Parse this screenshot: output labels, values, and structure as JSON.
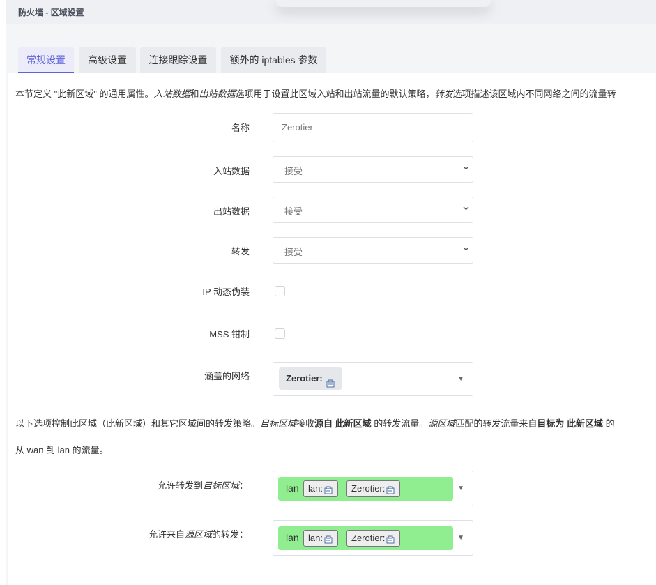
{
  "header": {
    "title": "防火墙 - 区域设置"
  },
  "tabs": [
    {
      "label": "常规设置",
      "active": true
    },
    {
      "label": "高级设置",
      "active": false
    },
    {
      "label": "连接跟踪设置",
      "active": false
    },
    {
      "label": "额外的 iptables 参数",
      "active": false
    }
  ],
  "intro": {
    "t1": "本节定义 \"此新区域\" 的通用属性。",
    "i1": "入站数据",
    "t2": "和",
    "i2": "出站数据",
    "t3": "选项用于设置此区域入站和出站流量的默认策略，",
    "i3": "转发",
    "t4": "选项描述该区域内不同网络之间的流量转"
  },
  "form": {
    "name": {
      "label": "名称",
      "value": "Zerotier"
    },
    "input": {
      "label": "入站数据",
      "value": "接受"
    },
    "output": {
      "label": "出站数据",
      "value": "接受"
    },
    "forward": {
      "label": "转发",
      "value": "接受"
    },
    "masq": {
      "label": "IP 动态伪装",
      "checked": false
    },
    "mss": {
      "label": "MSS 钳制",
      "checked": false
    },
    "networks": {
      "label": "涵盖的网络",
      "chip": "Zerotier:"
    }
  },
  "forwarding_desc": {
    "t1": "以下选项控制此区域（此新区域）和其它区域间的转发策略。",
    "i1": "目标区域",
    "t2": "接收",
    "b1": "源自 此新区域",
    "t3": " 的转发流量。",
    "i2": "源区域",
    "t4": "匹配的转发流量来自",
    "b2": "目标为 此新区域",
    "t5": " 的",
    "line2": "从 wan 到 lan 的流量。"
  },
  "dest": {
    "label_pre": "允许转发到",
    "label_em": "目标区域",
    "label_post": "：",
    "zone": "lan",
    "tag1": "lan:",
    "tag2": "Zerotier:",
    "zone_color": "#90ee90"
  },
  "src": {
    "label_pre": "允许来自",
    "label_em": "源区域",
    "label_post": "的转发：",
    "zone": "lan",
    "tag1": "lan:",
    "tag2": "Zerotier:",
    "zone_color": "#90ee90"
  },
  "colors": {
    "accent": "#5e63d9",
    "tab_bg": "#e9ebef",
    "zone_green": "#90ee90"
  },
  "icons": {
    "select_arrow": "chevron-down-icon",
    "dropdown": "triangle-down-icon",
    "network": "network-port-icon"
  }
}
